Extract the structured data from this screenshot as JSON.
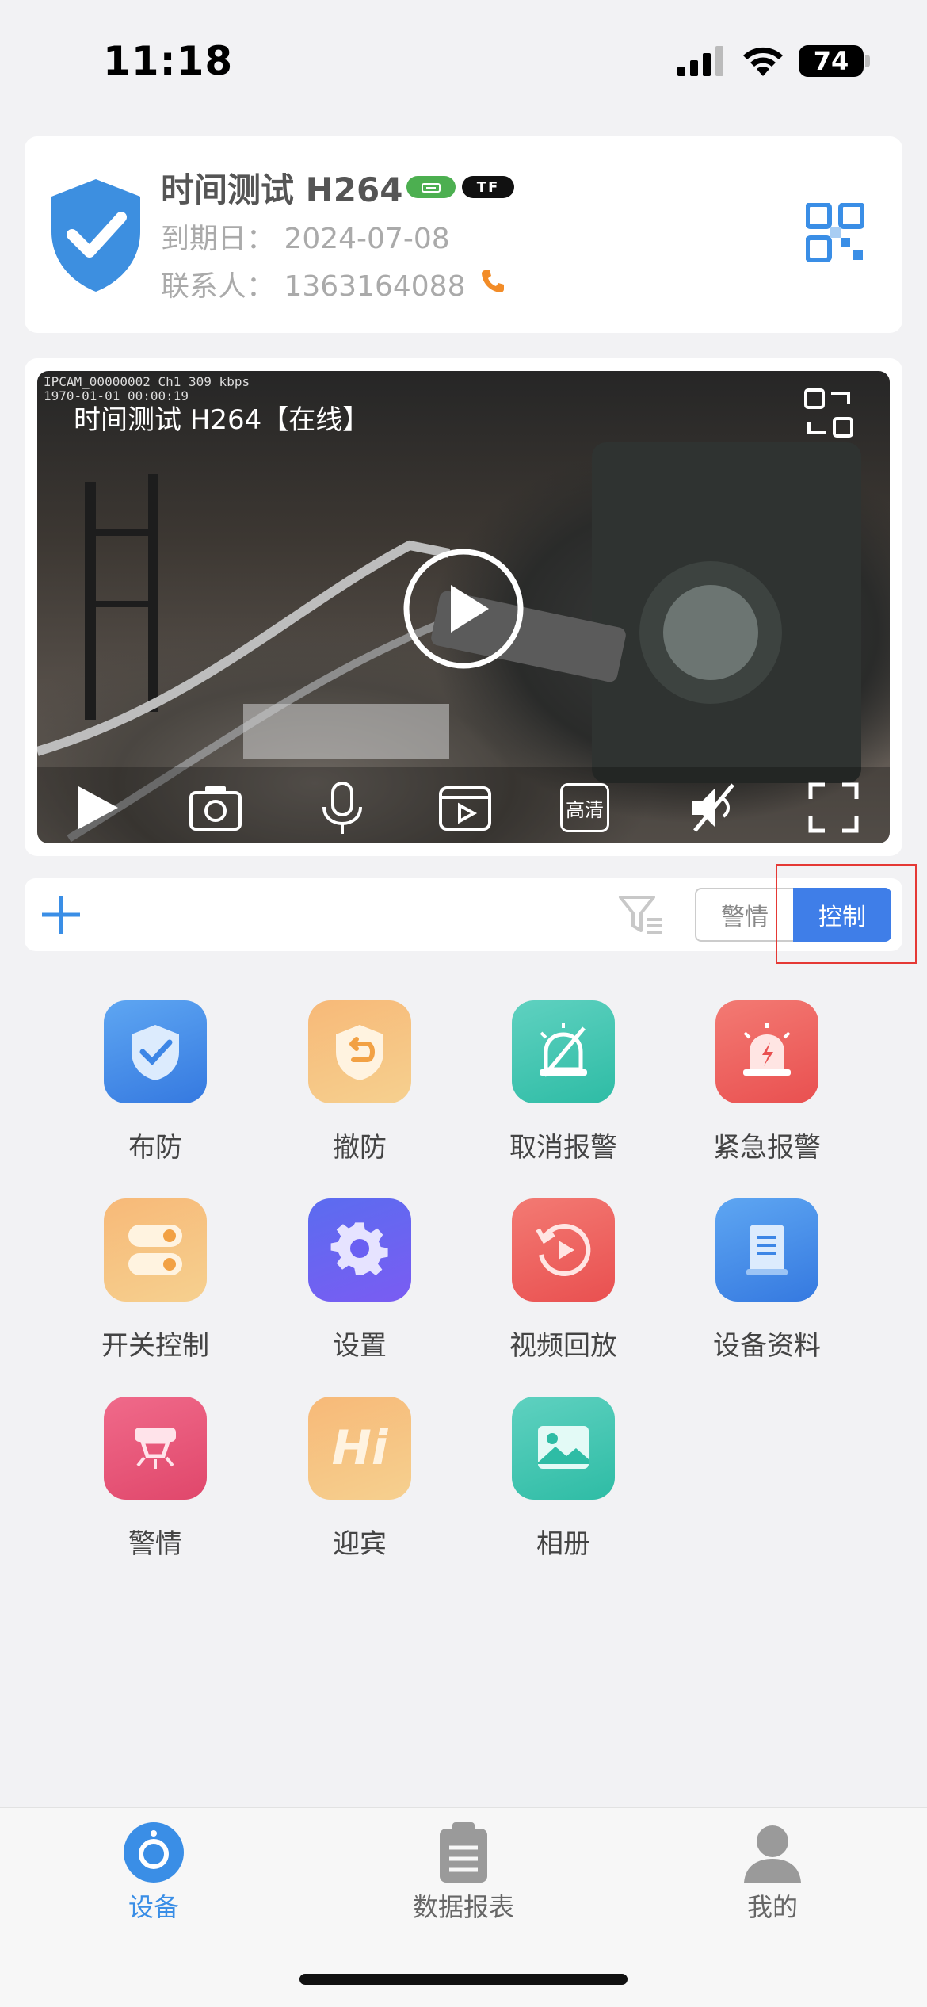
{
  "status_bar": {
    "time": "11:18",
    "battery": "74"
  },
  "device": {
    "name": "时间测试 H264",
    "badge_tf": "TF",
    "expiry": "到期日：  2024-07-08",
    "contact": "联系人：  1363164088"
  },
  "video": {
    "osd_line1": "IPCAM_00000002 Ch1   309 kbps",
    "osd_line2": "1970-01-01 00:00:19",
    "title": "时间测试 H264【在线】",
    "hd_label": "高清"
  },
  "toolbar": {
    "seg_alarm": "警情",
    "seg_control": "控制"
  },
  "grid": [
    {
      "label": "布防",
      "icon": "shield-check-icon"
    },
    {
      "label": "撤防",
      "icon": "shield-undo-icon"
    },
    {
      "label": "取消报警",
      "icon": "alarm-off-icon"
    },
    {
      "label": "紧急报警",
      "icon": "emergency-alarm-icon"
    },
    {
      "label": "开关控制",
      "icon": "switch-control-icon"
    },
    {
      "label": "设置",
      "icon": "gear-icon"
    },
    {
      "label": "视频回放",
      "icon": "replay-icon"
    },
    {
      "label": "设备资料",
      "icon": "document-icon"
    },
    {
      "label": "警情",
      "icon": "alert-sensor-icon"
    },
    {
      "label": "迎宾",
      "icon": "hi-icon"
    },
    {
      "label": "相册",
      "icon": "image-icon"
    }
  ],
  "tabs": [
    {
      "label": "设备",
      "active": true
    },
    {
      "label": "数据报表",
      "active": false
    },
    {
      "label": "我的",
      "active": false
    }
  ],
  "colors": {
    "accent": "#3f7ee8",
    "tab_active": "#3a8ee6",
    "badge_green": "#4caf50",
    "highlight": "#e53935"
  }
}
